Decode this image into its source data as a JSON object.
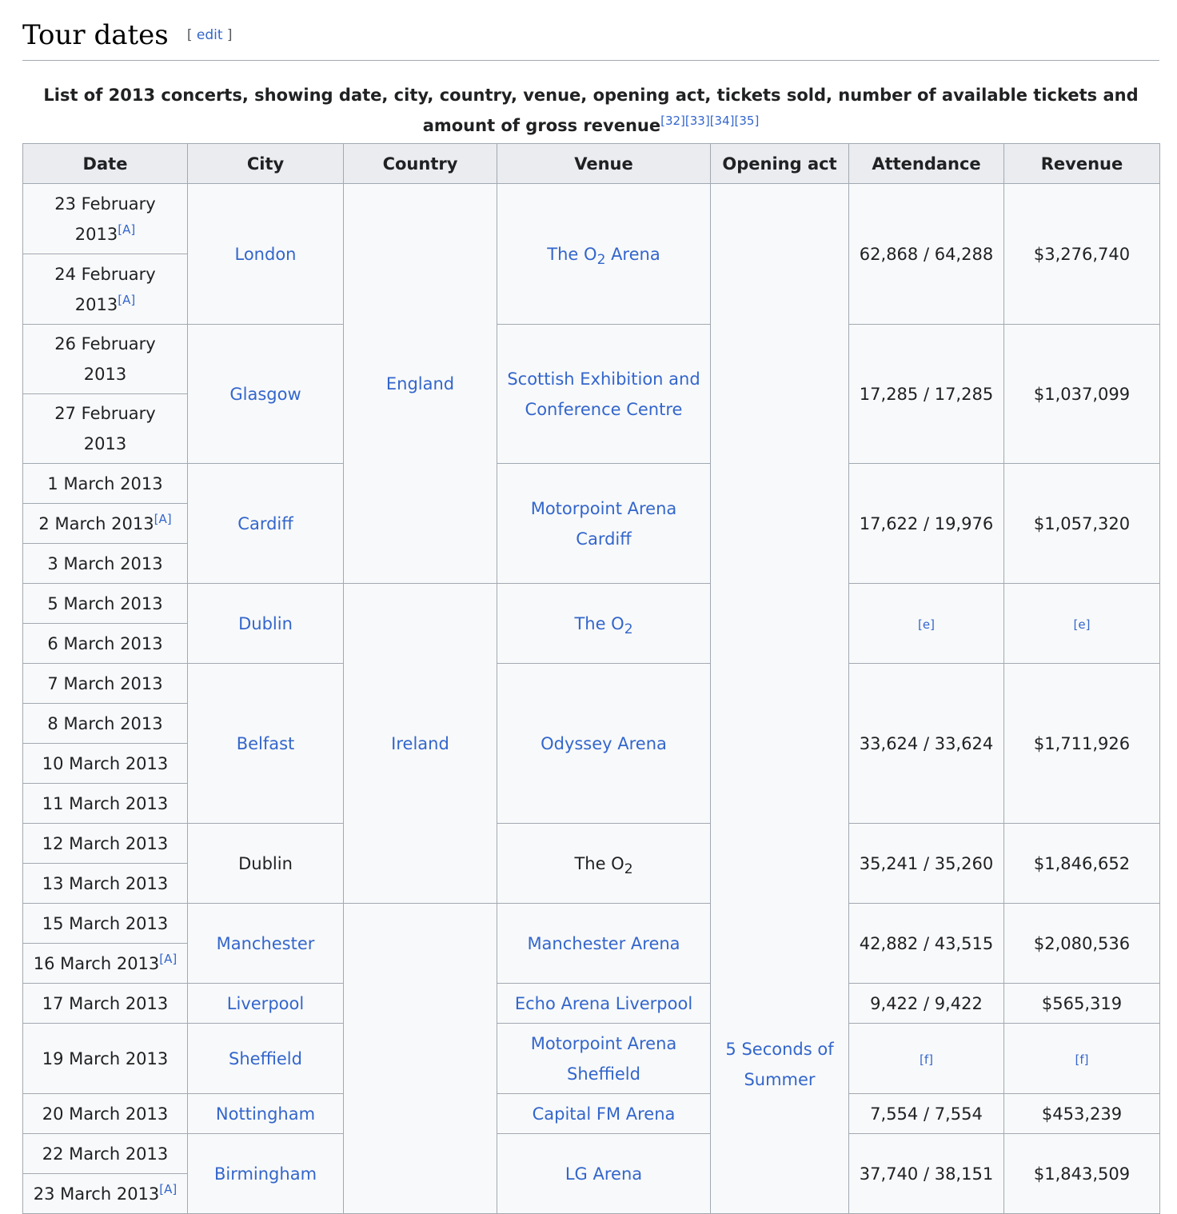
{
  "section": {
    "title": "Tour dates",
    "edit_open": "[ ",
    "edit_label": "edit",
    "edit_close": " ]"
  },
  "caption": {
    "text": "List of 2013 concerts, showing date, city, country, venue, opening act, tickets sold, number of available tickets and amount of gross revenue",
    "refs": [
      "[32]",
      "[33]",
      "[34]",
      "[35]"
    ]
  },
  "table": {
    "headers": [
      "Date",
      "City",
      "Country",
      "Venue",
      "Opening act",
      "Attendance",
      "Revenue"
    ],
    "dates": [
      {
        "text": "23 February 2013",
        "ref": "[A]"
      },
      {
        "text": "24 February 2013",
        "ref": "[A]"
      },
      {
        "text": "26 February 2013",
        "ref": ""
      },
      {
        "text": "27 February 2013",
        "ref": ""
      },
      {
        "text": "1 March 2013",
        "ref": ""
      },
      {
        "text": "2 March 2013",
        "ref": "[A]"
      },
      {
        "text": "3 March 2013",
        "ref": ""
      },
      {
        "text": "5 March 2013",
        "ref": ""
      },
      {
        "text": "6 March 2013",
        "ref": ""
      },
      {
        "text": "7 March 2013",
        "ref": ""
      },
      {
        "text": "8 March 2013",
        "ref": ""
      },
      {
        "text": "10 March 2013",
        "ref": ""
      },
      {
        "text": "11 March 2013",
        "ref": ""
      },
      {
        "text": "12 March 2013",
        "ref": ""
      },
      {
        "text": "13 March 2013",
        "ref": ""
      },
      {
        "text": "15 March 2013",
        "ref": ""
      },
      {
        "text": "16 March 2013",
        "ref": "[A]"
      },
      {
        "text": "17 March 2013",
        "ref": ""
      },
      {
        "text": "19 March 2013",
        "ref": ""
      },
      {
        "text": "20 March 2013",
        "ref": ""
      },
      {
        "text": "22 March 2013",
        "ref": ""
      },
      {
        "text": "23 March 2013",
        "ref": "[A]"
      }
    ],
    "cities": [
      "London",
      "Glasgow",
      "Cardiff",
      "Dublin",
      "Belfast",
      "Dublin",
      "Manchester",
      "Liverpool",
      "Sheffield",
      "Nottingham",
      "Birmingham"
    ],
    "countries": [
      "England",
      "Ireland"
    ],
    "venues": [
      {
        "text": "The O",
        "sub": "2",
        "after": " Arena"
      },
      {
        "text": "Scottish Exhibition and Conference Centre"
      },
      {
        "text": "Motorpoint Arena Cardiff"
      },
      {
        "text": "The O",
        "sub": "2",
        "after": ""
      },
      {
        "text": "Odyssey Arena"
      },
      {
        "text": "The O",
        "sub": "2",
        "after": ""
      },
      {
        "text": "Manchester Arena"
      },
      {
        "text": "Echo Arena Liverpool"
      },
      {
        "text": "Motorpoint Arena Sheffield"
      },
      {
        "text": "Capital FM Arena"
      },
      {
        "text": "LG Arena"
      }
    ],
    "opening_act": "5 Seconds of Summer",
    "attendance": [
      "62,868 / 64,288",
      "17,285 / 17,285",
      "17,622 / 19,976",
      "[e]",
      "33,624 / 33,624",
      "35,241 / 35,260",
      "42,882 / 43,515",
      "9,422 / 9,422",
      "[f]",
      "7,554 / 7,554",
      "37,740 / 38,151"
    ],
    "revenue": [
      "$3,276,740",
      "$1,037,099",
      "$1,057,320",
      "[e]",
      "$1,711,926",
      "$1,846,652",
      "$2,080,536",
      "$565,319",
      "[f]",
      "$453,239",
      "$1,843,509"
    ]
  }
}
